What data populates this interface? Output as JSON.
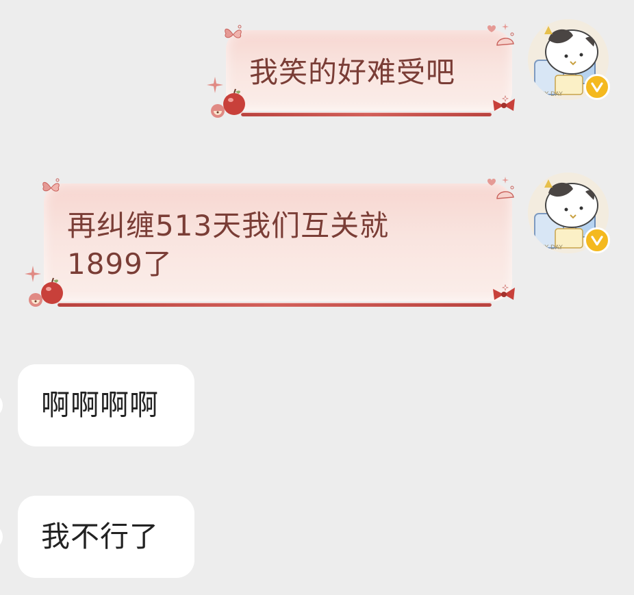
{
  "messages": [
    {
      "direction": "outgoing",
      "text": "我笑的好难受吧",
      "bubble_style": "decorated-pink-apple-bow",
      "avatar": "cow-cat-avatar",
      "avatar_badge": "verified-v-badge"
    },
    {
      "direction": "outgoing",
      "text": "再纠缠513天我们互关就\n1899了",
      "bubble_style": "decorated-pink-apple-bow",
      "avatar": "cow-cat-avatar",
      "avatar_badge": "verified-v-badge"
    },
    {
      "direction": "incoming",
      "text": "啊啊啊啊",
      "bubble_style": "plain-white"
    },
    {
      "direction": "incoming",
      "text": "我不行了",
      "bubble_style": "plain-white"
    }
  ],
  "colors": {
    "background": "#ededed",
    "outgoing_bubble": "#f9e4df",
    "outgoing_text": "#7a3d36",
    "outgoing_rule": "#b9433f",
    "incoming_bubble": "#ffffff",
    "incoming_text": "#222222",
    "badge": "#f4b91f"
  }
}
